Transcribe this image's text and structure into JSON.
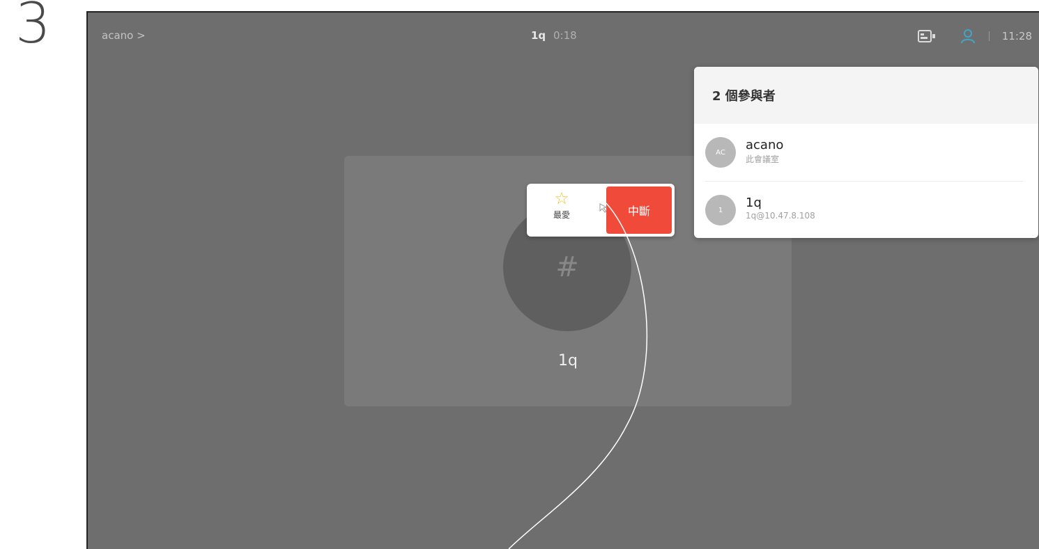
{
  "step": "3",
  "header": {
    "breadcrumb": "acano >",
    "call_name": "1q",
    "call_duration": "0:18",
    "clock": "11:28"
  },
  "tile": {
    "avatar_glyph": "#",
    "name": "1q"
  },
  "action_popup": {
    "favorite_label": "最愛",
    "end_label": "中斷"
  },
  "participants": {
    "title": "2 個參與者",
    "items": [
      {
        "initials": "AC",
        "name": "acano",
        "sub": "此會議室"
      },
      {
        "initials": "1",
        "name": "1q",
        "sub": "1q@10.47.8.108"
      }
    ]
  },
  "colors": {
    "end_button": "#f04a3a",
    "favorite_star": "#f2c230",
    "people_icon": "#3fa6c8"
  }
}
